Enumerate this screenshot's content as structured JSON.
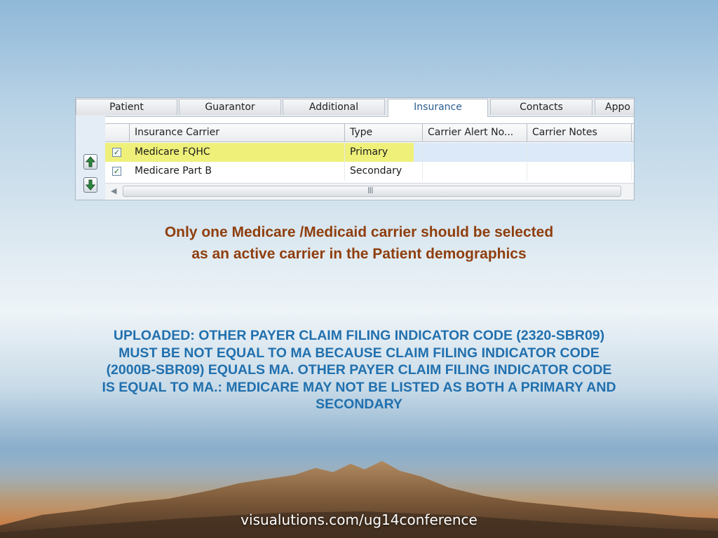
{
  "tabs": [
    "Patient",
    "Guarantor",
    "Additional",
    "Insurance",
    "Contacts",
    "Appo"
  ],
  "active_tab": "Insurance",
  "grid": {
    "columns": [
      "Insurance Carrier",
      "Type",
      "Carrier Alert No...",
      "Carrier Notes"
    ],
    "rows": [
      {
        "checked": "✓",
        "carrier": "Medicare FQHC",
        "type": "Primary",
        "alert": "",
        "notes": ""
      },
      {
        "checked": "✓",
        "carrier": "Medicare Part B",
        "type": "Secondary",
        "alert": "",
        "notes": ""
      }
    ],
    "scroll_grip": "III"
  },
  "caption": [
    "Only one Medicare /Medicaid carrier should be selected",
    "as an active carrier in the Patient demographics"
  ],
  "error_lines": [
    "UPLOADED: OTHER PAYER CLAIM FILING INDICATOR CODE (2320-SBR09)",
    "MUST BE NOT EQUAL TO MA BECAUSE CLAIM FILING INDICATOR CODE",
    "(2000B-SBR09) EQUALS MA. OTHER PAYER CLAIM FILING INDICATOR CODE",
    "IS EQUAL TO MA.: MEDICARE MAY NOT BE LISTED AS BOTH A PRIMARY AND",
    "SECONDARY"
  ],
  "footer": "visualutions.com/ug14conference",
  "colors": {
    "caption": "#8f3e0d",
    "error": "#2170ae",
    "highlight": "#eef07a",
    "active_tab_text": "#2a5d8f"
  }
}
